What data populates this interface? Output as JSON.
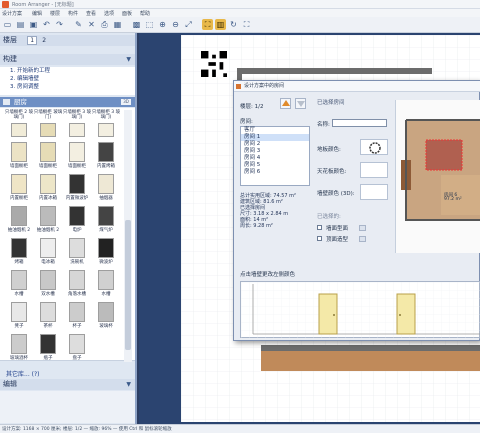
{
  "window": {
    "title": "Room Arranger - [无标题]"
  },
  "menu": [
    "设计方案",
    "编辑",
    "楼层",
    "构件",
    "查看",
    "选项",
    "面板",
    "帮助"
  ],
  "toolbar": {
    "buttons": [
      "new-icon",
      "open-icon",
      "save-icon",
      "undo-icon",
      "redo-icon",
      "brush-icon",
      "delete-icon",
      "print-icon",
      "camera-icon",
      "grid-icon",
      "select-icon",
      "zoom-in-icon",
      "zoom-out-icon",
      "zoom-fit-icon",
      "zoom-all-icon",
      "floors-icon",
      "rotate-icon",
      "fullscreen-icon"
    ],
    "active": [
      14,
      15
    ]
  },
  "left": {
    "floors_title": "楼层",
    "floor_tabs": [
      "1",
      "2"
    ],
    "build_title": "构建",
    "build_steps": [
      "1. 开始新的工程",
      "2. 编辑墙壁",
      "3. 房间调整"
    ],
    "category": "厨房",
    "category_badge": "3D",
    "catalog": [
      [
        "只墙橱柜 2 玻璃门)",
        "只墙橱柜 玻璃门)",
        "只墙橱柜 3 玻璃门)",
        "只墙橱柜 3 玻璃门)"
      ],
      [
        "墙面橱柜",
        "墙面橱柜",
        "墙面橱柜",
        "内置烤箱"
      ],
      [
        "内置橱柜",
        "内置冰箱",
        "内置微波炉",
        "抽烟器"
      ],
      [
        "抽油烟机 2",
        "抽油烟机 2",
        "电炉",
        "煤气炉"
      ],
      [
        "烤箱",
        "电冰箱",
        "洗碗机",
        "微波炉"
      ],
      [
        "水槽",
        "双水槽",
        "角落水槽",
        "水槽"
      ],
      [
        "凳子",
        "茶杯",
        "杯子",
        "玻璃杯"
      ],
      [
        "玻璃酒杯",
        "瓶子",
        "盘子",
        ""
      ]
    ],
    "more_link": "其它库... (?)",
    "edit_title": "编辑"
  },
  "status": "设计方案: 1168 × 700 厘米; 楼层: 1/2 — 缩放: 96% — 使用 Ctrl 和 鼠标滚轮缩放",
  "dialog": {
    "title": "设计方案中的房间",
    "floor_label": "楼层: 1/2",
    "rooms_label": "房间:",
    "rooms": [
      "客厅",
      "房间 1",
      "房间 2",
      "房间 3",
      "房间 4",
      "房间 5",
      "房间 6"
    ],
    "selected_room": 1,
    "selected_header": "已选择房间",
    "name_label": "名称:",
    "name_value": "",
    "floor_color": "地板颜色:",
    "ceiling_color": "天花板颜色:",
    "wall_color": "墙壁颜色 (3D):",
    "options_header": "已选择的:",
    "check1": "墙面型面",
    "check2": "顶面造型",
    "stats": [
      "总计实用区域: 74.57 m²",
      "建筑区域: 81.6 m²",
      "已选择房间",
      "尺寸: 3.18 x 2.84 m",
      "面积: 14 m²",
      "周长: 9.28 m²"
    ],
    "elevation_label": "点击墙壁更改左侧颜色",
    "preview_room_label": "房间 6",
    "preview_area": "97.2 m²"
  },
  "colors": {
    "accent": "#e8b84a",
    "panel": "#dfe7f2",
    "category": "#6e8fc4",
    "floor": "#a5683d"
  }
}
